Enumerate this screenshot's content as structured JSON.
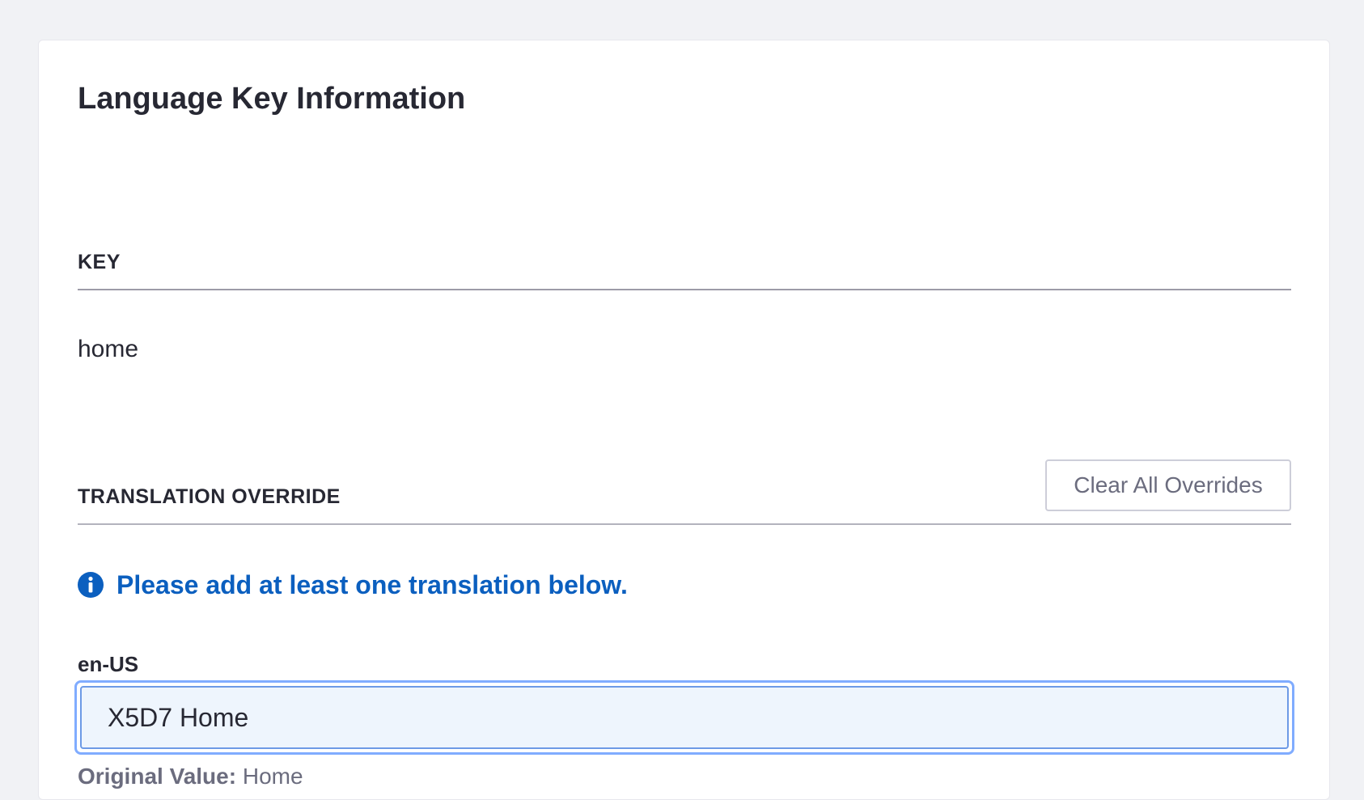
{
  "card": {
    "title": "Language Key Information"
  },
  "key_section": {
    "label": "KEY",
    "value": "home"
  },
  "override_section": {
    "label": "TRANSLATION OVERRIDE",
    "clear_button_label": "Clear All Overrides",
    "info_message": "Please add at least one translation below.",
    "info_icon": "info-circle-icon",
    "field_label": "en-US",
    "field_value": "X5D7 Home",
    "original_label": "Original Value:",
    "original_value": "Home"
  },
  "colors": {
    "page_background": "#f1f2f5",
    "info_blue": "#0b5fbf",
    "focus_ring": "#80acff",
    "input_background": "#eef5fd",
    "muted_text": "#6b6c7e"
  }
}
